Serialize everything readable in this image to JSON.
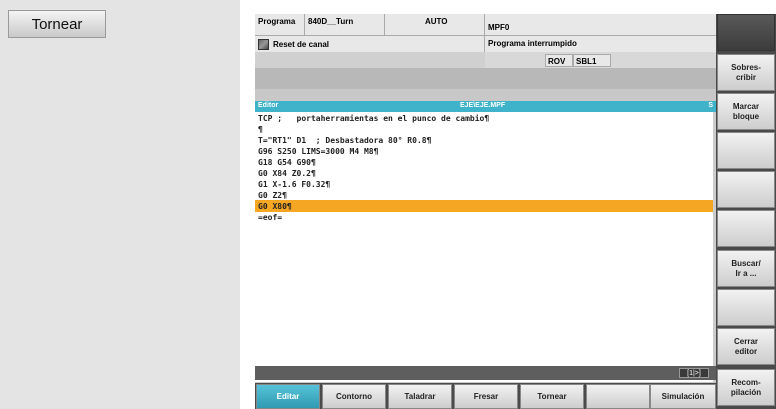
{
  "side": {
    "tornear_button": "Tornear"
  },
  "header": {
    "programa": "Programa",
    "path": "840D__Turn",
    "mode": "AUTO",
    "file": "MPF0",
    "reset": "Reset de canal",
    "state": "Programa interrumpido",
    "rov": "ROV",
    "sbl": "SBL1"
  },
  "editor": {
    "title_left": "Editor",
    "file_name": "EJE\\EJE.MPF",
    "title_right": "S",
    "lines": [
      "TCP ;   portaherramientas en el punco de cambio¶",
      "¶",
      "T=\"RT1\" D1  ; Desbastadora 80° R0.8¶",
      "G96 S250 LIMS=3000 M4 M8¶",
      "G18 G54 G90¶",
      "G0 X84 Z0.2¶",
      "G1 X-1.6 F0.32¶",
      "G0 Z2¶",
      "G0 X80¶",
      "=eof="
    ],
    "highlighted_line": 8,
    "page_indicator": "[1|>]"
  },
  "vertical_softkeys": [
    {
      "label": "",
      "name": "vsk-blank-top"
    },
    {
      "label": "Sobres-\ncribir",
      "name": "vsk-sobrescribir"
    },
    {
      "label": "Marcar\nbloque",
      "name": "vsk-marcar-bloque"
    },
    {
      "label": "",
      "name": "vsk-blank-4"
    },
    {
      "label": "",
      "name": "vsk-blank-5"
    },
    {
      "label": "",
      "name": "vsk-blank-6"
    },
    {
      "label": "Buscar/\nIr a ...",
      "name": "vsk-buscar"
    },
    {
      "label": "",
      "name": "vsk-blank-8"
    },
    {
      "label": "Cerrar\neditor",
      "name": "vsk-cerrar-editor"
    },
    {
      "label": "Recom-\npilación",
      "name": "vsk-recompilacion"
    }
  ],
  "horizontal_softkeys": [
    {
      "label": "Editar",
      "name": "hsk-editar",
      "active": true
    },
    {
      "label": "Contorno",
      "name": "hsk-contorno"
    },
    {
      "label": "Taladrar",
      "name": "hsk-taladrar"
    },
    {
      "label": "Fresar",
      "name": "hsk-fresar"
    },
    {
      "label": "Tornear",
      "name": "hsk-tornear"
    },
    {
      "label": "",
      "name": "hsk-blank"
    },
    {
      "label": "Simulación",
      "name": "hsk-simulacion"
    }
  ],
  "colors": {
    "accent": "#3fb3c9",
    "highlight": "#f5a623",
    "active_key": "#2f9ab2"
  }
}
